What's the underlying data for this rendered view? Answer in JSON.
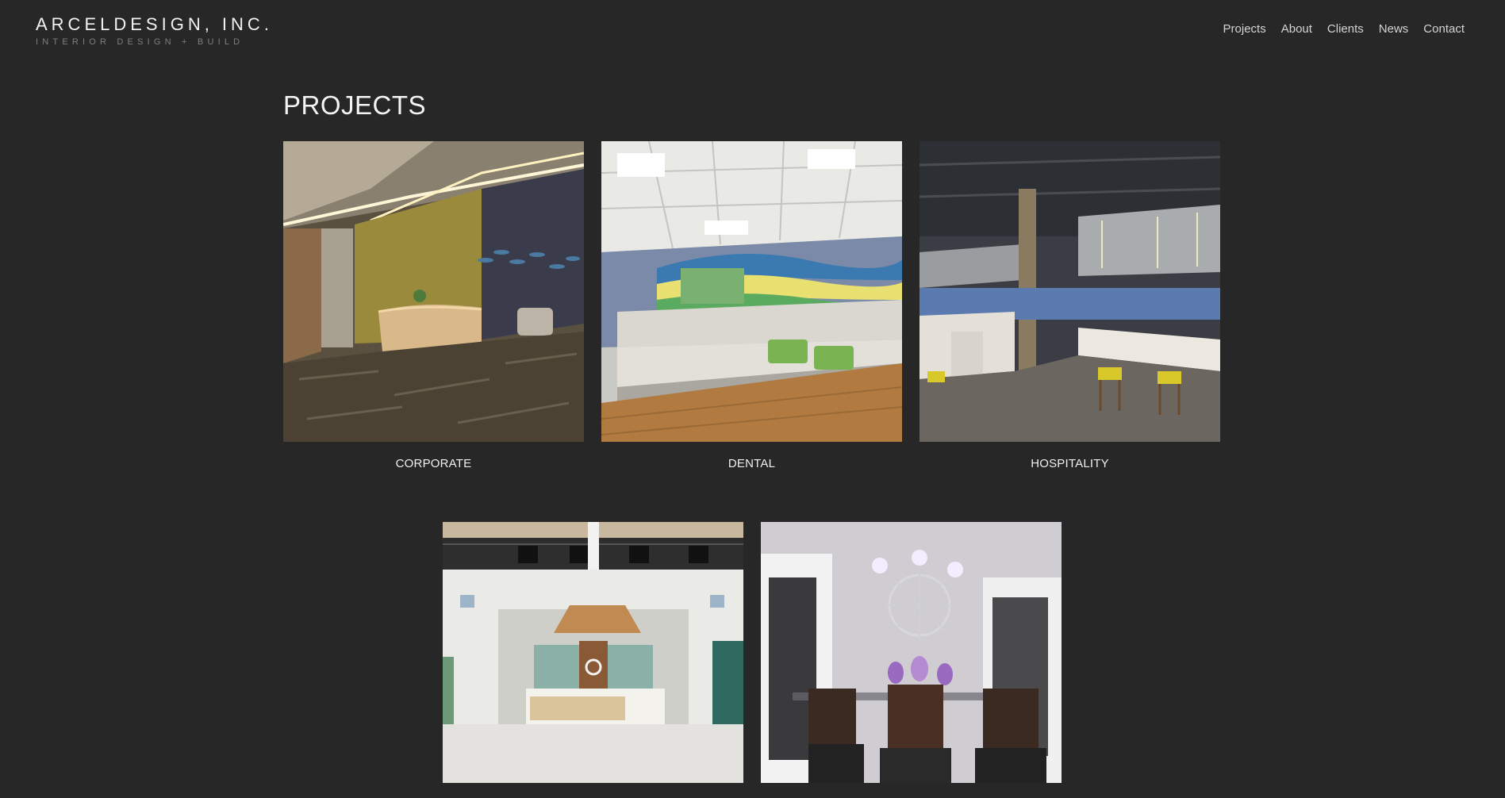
{
  "brand": {
    "title": "ARCELDESIGN, INC.",
    "tagline": "INTERIOR DESIGN + BUILD"
  },
  "nav": {
    "items": [
      {
        "label": "Projects"
      },
      {
        "label": "About"
      },
      {
        "label": "Clients"
      },
      {
        "label": "News"
      },
      {
        "label": "Contact"
      }
    ]
  },
  "main": {
    "title": "PROJECTS",
    "projects": [
      {
        "caption": "CORPORATE"
      },
      {
        "caption": "DENTAL"
      },
      {
        "caption": "HOSPITALITY"
      },
      {
        "caption": ""
      },
      {
        "caption": ""
      }
    ]
  },
  "colors": {
    "background": "#272727",
    "text": "#f0f0f0",
    "nav_text": "#d4d4d4",
    "tagline": "#7f7f7f"
  }
}
